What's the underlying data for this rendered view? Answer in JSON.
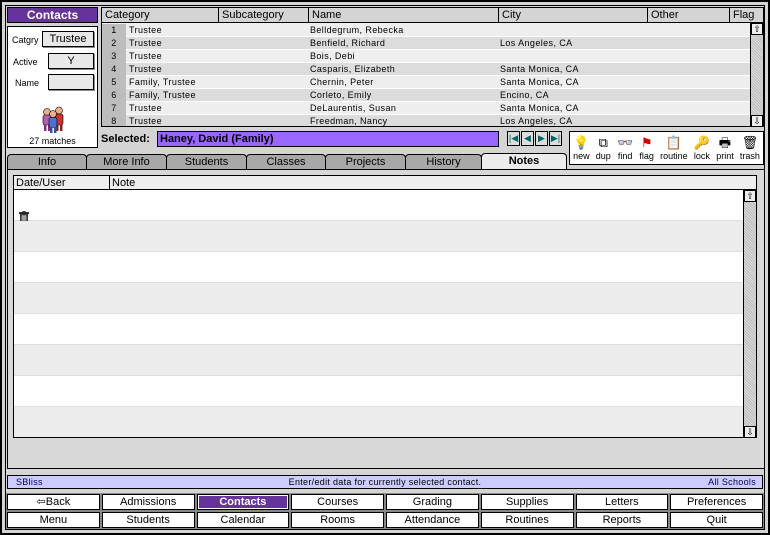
{
  "module": {
    "title": "Contacts"
  },
  "filters": {
    "category_label": "Catgry",
    "category_value": "Trustee",
    "active_label": "Active",
    "active_value": "Y",
    "name_label": "Name",
    "name_value": "",
    "matches": "27 matches"
  },
  "grid": {
    "columns": [
      "Category",
      "Subcategory",
      "Name",
      "City",
      "Other",
      "Flag"
    ],
    "rows": [
      {
        "n": "1",
        "category": "Trustee",
        "subcategory": "",
        "name": "Belldegrum, Rebecka",
        "city": "",
        "other": "",
        "flag": ""
      },
      {
        "n": "2",
        "category": "Trustee",
        "subcategory": "",
        "name": "Benfield, Richard",
        "city": "Los Angeles, CA",
        "other": "",
        "flag": ""
      },
      {
        "n": "3",
        "category": "Trustee",
        "subcategory": "",
        "name": "Bois, Debi",
        "city": "",
        "other": "",
        "flag": ""
      },
      {
        "n": "4",
        "category": "Trustee",
        "subcategory": "",
        "name": "Casparis, Elizabeth",
        "city": "Santa Monica, CA",
        "other": "",
        "flag": ""
      },
      {
        "n": "5",
        "category": "Family, Trustee",
        "subcategory": "",
        "name": "Chernin, Peter",
        "city": "Santa Monica, CA",
        "other": "",
        "flag": ""
      },
      {
        "n": "6",
        "category": "Family, Trustee",
        "subcategory": "",
        "name": "Corleto, Emily",
        "city": "Encino, CA",
        "other": "",
        "flag": ""
      },
      {
        "n": "7",
        "category": "Trustee",
        "subcategory": "",
        "name": "DeLaurentis, Susan",
        "city": "Santa Monica, CA",
        "other": "",
        "flag": ""
      },
      {
        "n": "8",
        "category": "Trustee",
        "subcategory": "",
        "name": "Freedman, Nancy",
        "city": "Los Angeles, CA",
        "other": "",
        "flag": ""
      }
    ]
  },
  "selected": {
    "label": "Selected:",
    "value": "Haney, David  (Family)"
  },
  "record_nav": [
    {
      "name": "first-record-button",
      "glyph": "|◀"
    },
    {
      "name": "prev-record-button",
      "glyph": "◀"
    },
    {
      "name": "next-record-button",
      "glyph": "▶"
    },
    {
      "name": "last-record-button",
      "glyph": "▶|"
    }
  ],
  "toolbar": [
    {
      "label": "new",
      "icon": "lightbulb-icon",
      "glyph": "💡"
    },
    {
      "label": "dup",
      "icon": "duplicate-icon",
      "glyph": "⧉"
    },
    {
      "label": "find",
      "icon": "glasses-icon",
      "glyph": "👓"
    },
    {
      "label": "flag",
      "icon": "flag-icon",
      "glyph": "⚑"
    },
    {
      "label": "routine",
      "icon": "clipboard-icon",
      "glyph": "📋"
    },
    {
      "label": "lock",
      "icon": "key-icon",
      "glyph": "🔑"
    },
    {
      "label": "print",
      "icon": "printer-icon",
      "glyph": "🖶"
    },
    {
      "label": "trash",
      "icon": "trash-icon",
      "glyph": "🗑"
    }
  ],
  "tabs": [
    "Info",
    "More Info",
    "Students",
    "Classes",
    "Projects",
    "History",
    "Notes"
  ],
  "active_tab": "Notes",
  "notes": {
    "columns": [
      "Date/User",
      "Note"
    ],
    "rows": []
  },
  "status": {
    "user": "SBliss",
    "message": "Enter/edit data for currently selected contact.",
    "scope": "All Schools"
  },
  "nav": {
    "row1": [
      "Back",
      "Admissions",
      "Contacts",
      "Courses",
      "Grading",
      "Supplies",
      "Letters",
      "Preferences"
    ],
    "row2": [
      "Menu",
      "Students",
      "Calendar",
      "Rooms",
      "Attendance",
      "Routines",
      "Reports",
      "Quit"
    ],
    "active": "Contacts"
  },
  "colors": {
    "accent": "#663399",
    "selected_field": "#9966ff",
    "status_bar": "#ccccff"
  }
}
